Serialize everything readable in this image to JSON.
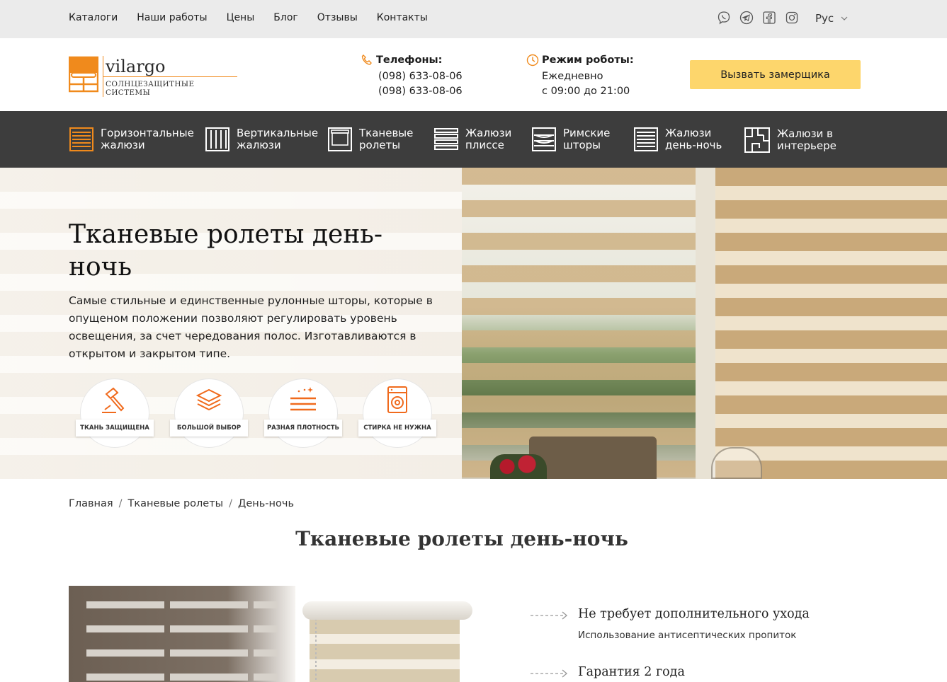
{
  "topnav": [
    "Каталоги",
    "Наши работы",
    "Цены",
    "Блог",
    "Отзывы",
    "Контакты"
  ],
  "social": [
    "viber-icon",
    "telegram-icon",
    "facebook-icon",
    "instagram-icon"
  ],
  "language": "Рус",
  "logo": {
    "name": "vilargo",
    "tagline": "СОЛНЦЕЗАЩИТНЫЕ СИСТЕМЫ"
  },
  "phones": {
    "label": "Телефоны:",
    "numbers": [
      "(098) 633-08-06",
      "(098) 633-08-06"
    ]
  },
  "hours": {
    "label": "Режим роботы:",
    "days": "Ежедневно",
    "time": "с 09:00 до 21:00"
  },
  "cta_label": "Вызвать замерщика",
  "categories": [
    {
      "label": "Горизонтальные\nжалюзи",
      "icon": "horizontal-blinds-icon"
    },
    {
      "label": "Вертикальные\nжалюзи",
      "icon": "vertical-blinds-icon"
    },
    {
      "label": "Тканевые\nролеты",
      "icon": "roller-blind-icon"
    },
    {
      "label": "Жалюзи\nплиссе",
      "icon": "pleated-blinds-icon"
    },
    {
      "label": "Римские\nшторы",
      "icon": "roman-shade-icon"
    },
    {
      "label": "Жалюзи\nдень-ночь",
      "icon": "day-night-blinds-icon"
    },
    {
      "label": "Жалюзи в\nинтерьере",
      "icon": "interior-plan-icon"
    }
  ],
  "hero": {
    "title": "Тканевые ролеты день-ночь",
    "description": "Самые стильные и единственные рулонные шторы, которые в опущеном положении позволяют регулировать уровень освещения, за счет чередования полос. Изготавливаются в открытом и закрытом типе.",
    "features": [
      {
        "label": "ТКАНЬ ЗАЩИЩЕНА",
        "icon": "hammer-icon"
      },
      {
        "label": "БОЛЬШОЙ ВЫБОР",
        "icon": "fabric-stack-icon"
      },
      {
        "label": "РАЗНАЯ ПЛОТНОСТЬ",
        "icon": "density-lines-icon"
      },
      {
        "label": "СТИРКА НЕ НУЖНА",
        "icon": "washing-machine-icon"
      }
    ]
  },
  "breadcrumb": [
    "Главная",
    "Тканевые ролеты",
    "День-ночь"
  ],
  "breadcrumb_separator": "/",
  "page_title": "Тканевые ролеты день-ночь",
  "benefits": [
    {
      "title": "Не требует дополнительного ухода",
      "subtitle": "Использование антисептических пропиток"
    },
    {
      "title": "Гарантия 2 года",
      "subtitle": ""
    }
  ],
  "colors": {
    "accent": "#f08a1c",
    "cta": "#fdd66c",
    "nav_bg": "#3d3d3d",
    "topbar_bg": "#ebebeb"
  }
}
